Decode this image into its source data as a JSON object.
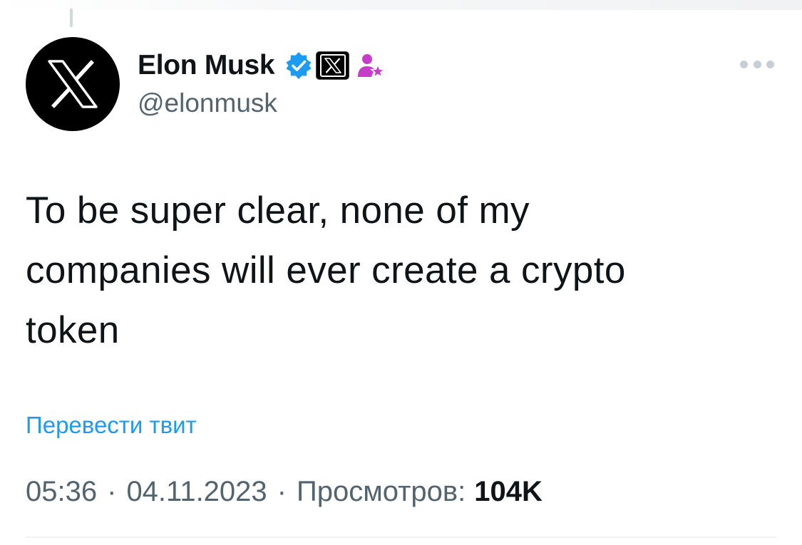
{
  "tweet": {
    "author": {
      "display_name": "Elon Musk",
      "handle": "@elonmusk",
      "avatar_icon": "x-logo-icon",
      "badges": [
        "verified-badge-icon",
        "x-affiliate-icon",
        "government-user-icon"
      ]
    },
    "text": "To be super clear, none of my\ncompanies will ever create a crypto\ntoken",
    "translate_label": "Перевести твит",
    "time": "05:36",
    "date": "04.11.2023",
    "separator": "·",
    "views_label": "Просмотров:",
    "views_count": "104K"
  },
  "colors": {
    "text_primary": "#0f1419",
    "text_secondary": "#536471",
    "link": "#1d9bf0",
    "verified": "#1d9bf0",
    "gov_badge": "#c53dc9"
  }
}
